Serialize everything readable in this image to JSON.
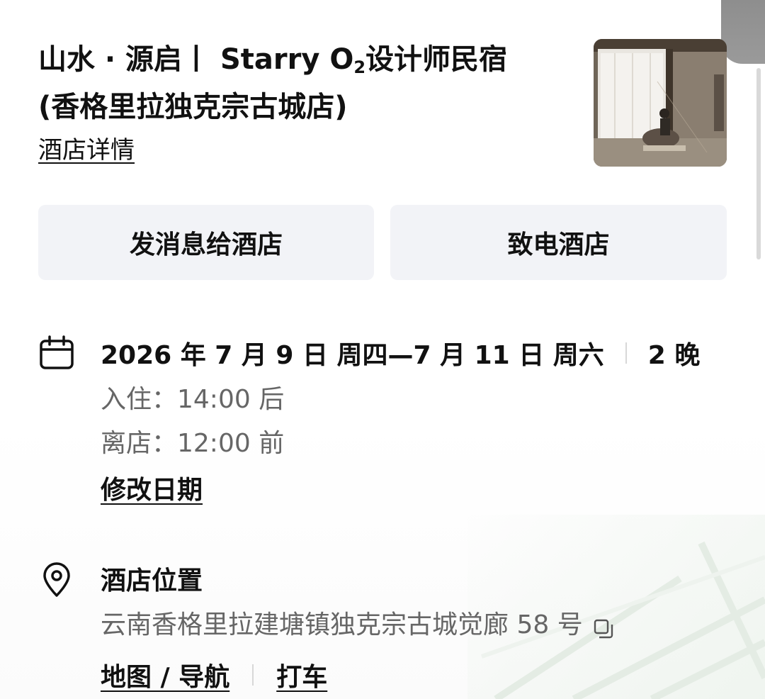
{
  "hotel": {
    "title_line1_a": "山水 · 源启丨 Starry O",
    "title_line1_sub": "2",
    "title_line1_b": "设计师民宿",
    "title_line2": "(香格里拉独克宗古城店)",
    "detail_link": "酒店详情",
    "photo_icon": "hotel-room-photo"
  },
  "actions": {
    "message_label": "发消息给酒店",
    "call_label": "致电酒店"
  },
  "stay": {
    "icon": "calendar-icon",
    "dates": "2026 年 7 月 9 日 周四—7 月 11 日 周六",
    "nights": "2 晚",
    "checkin": "入住：14:00 后",
    "checkout": "离店：12:00 前",
    "change_date": "修改日期"
  },
  "location": {
    "icon": "location-pin-icon",
    "title": "酒店位置",
    "address": "云南香格里拉建塘镇独克宗古城觉廊 58 号",
    "copy_icon": "copy-icon",
    "map_nav": "地图 / 导航",
    "taxi": "打车"
  },
  "colors": {
    "text_primary": "#111111",
    "text_secondary": "#666666",
    "button_bg": "#f2f3f7",
    "corner_tab": "#8e8e8e"
  }
}
